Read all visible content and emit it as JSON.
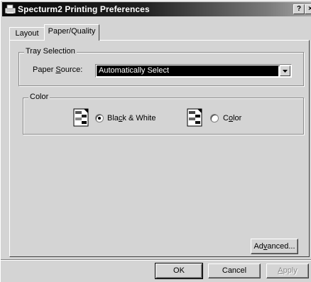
{
  "window": {
    "title": "Specturm2 Printing Preferences",
    "help_button": "?",
    "close_button": "×"
  },
  "tabs": [
    {
      "label": "Layout",
      "active": false
    },
    {
      "label": "Paper/Quality",
      "active": true
    }
  ],
  "tray_selection": {
    "group_label": "Tray Selection",
    "paper_source_prefix": "Paper ",
    "paper_source_underline": "S",
    "paper_source_suffix": "ource:",
    "paper_source_value": "Automatically Select"
  },
  "color": {
    "group_label": "Color",
    "options": [
      {
        "label_prefix": "Bla",
        "label_underline": "c",
        "label_suffix": "k & White",
        "selected": true
      },
      {
        "label_prefix": "C",
        "label_underline": "o",
        "label_suffix": "lor",
        "selected": false
      }
    ]
  },
  "advanced_button": {
    "prefix": "Ad",
    "underline": "v",
    "suffix": "anced..."
  },
  "footer": {
    "ok": "OK",
    "cancel": "Cancel",
    "apply_underline": "A",
    "apply_suffix": "pply"
  },
  "icons": {
    "window_icon": "printer-icon",
    "bw_icon": "black-white-document-icon",
    "color_icon": "color-document-icon"
  }
}
